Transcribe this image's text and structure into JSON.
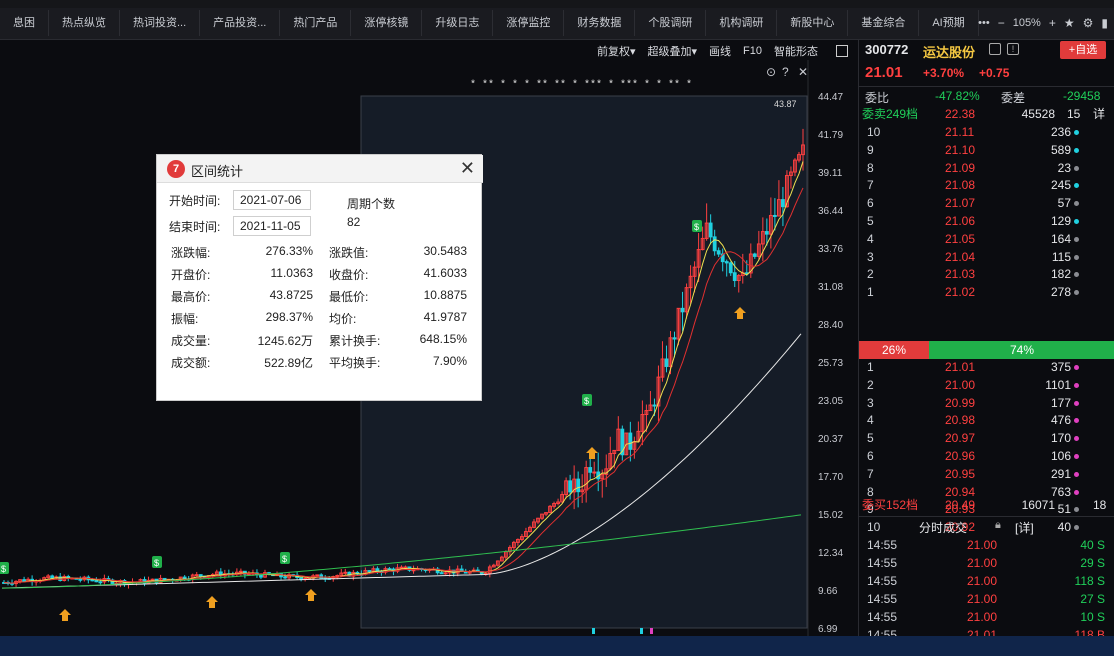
{
  "topnav": {
    "tabs": [
      "息困",
      "热点纵览",
      "热词投资...",
      "产品投资...",
      "热门产品",
      "涨停核镜",
      "升级日志",
      "涨停监控",
      "财务数据",
      "个股调研",
      "机构调研",
      "新股中心",
      "基金综合",
      "AI预期"
    ],
    "more": "•••",
    "zoom_minus": "−",
    "zoom": "105%",
    "zoom_plus": "+"
  },
  "chart_toolbar": [
    "前复权▾",
    "超级叠加▾",
    "画线",
    "F10",
    "智能形态"
  ],
  "chart": {
    "price_ticks": [
      "44.47",
      "41.79",
      "39.11",
      "36.44",
      "33.76",
      "31.08",
      "28.40",
      "25.73",
      "23.05",
      "20.37",
      "17.70",
      "15.02",
      "12.34",
      "9.66",
      "6.99"
    ],
    "hover_value": "43.87",
    "star_marks": "* ** * * *     **   **   *  ***  *    *** *             *          **     *"
  },
  "stock": {
    "code": "300772",
    "name": "运达股份",
    "add_label": "+自选",
    "price": "21.01",
    "pct": "+3.70%",
    "chg": "+0.75",
    "weibi_label": "委比",
    "weibi": "-47.82%",
    "weicha_label": "委差",
    "weicha": "-29458",
    "sell_header_label": "委卖249档",
    "sell_header_price": "22.38",
    "sell_header_qty": "45528",
    "sell_header_count": "15",
    "sell_header_detail": "详",
    "sell": [
      {
        "lv": "10",
        "p": "21.11",
        "q": "236"
      },
      {
        "lv": "9",
        "p": "21.10",
        "q": "589"
      },
      {
        "lv": "8",
        "p": "21.09",
        "q": "23"
      },
      {
        "lv": "7",
        "p": "21.08",
        "q": "245"
      },
      {
        "lv": "6",
        "p": "21.07",
        "q": "57"
      },
      {
        "lv": "5",
        "p": "21.06",
        "q": "129"
      },
      {
        "lv": "4",
        "p": "21.05",
        "q": "164"
      },
      {
        "lv": "3",
        "p": "21.04",
        "q": "115"
      },
      {
        "lv": "2",
        "p": "21.03",
        "q": "182"
      },
      {
        "lv": "1",
        "p": "21.02",
        "q": "278"
      }
    ],
    "ratio_red": "26%",
    "ratio_green": "74%",
    "buy": [
      {
        "lv": "1",
        "p": "21.01",
        "q": "375"
      },
      {
        "lv": "2",
        "p": "21.00",
        "q": "1101"
      },
      {
        "lv": "3",
        "p": "20.99",
        "q": "177"
      },
      {
        "lv": "4",
        "p": "20.98",
        "q": "476"
      },
      {
        "lv": "5",
        "p": "20.97",
        "q": "170"
      },
      {
        "lv": "6",
        "p": "20.96",
        "q": "106"
      },
      {
        "lv": "7",
        "p": "20.95",
        "q": "291"
      },
      {
        "lv": "8",
        "p": "20.94",
        "q": "763"
      },
      {
        "lv": "9",
        "p": "20.93",
        "q": "51"
      },
      {
        "lv": "10",
        "p": "20.92",
        "q": "40"
      }
    ],
    "buy_header_label": "委买152档",
    "buy_header_price": "20.49",
    "buy_header_qty": "16071",
    "buy_header_count": "18",
    "trades_title": "分时成交",
    "trades_detail": "[详]",
    "trades": [
      {
        "t": "14:55",
        "p": "21.00",
        "v": "40 S"
      },
      {
        "t": "14:55",
        "p": "21.00",
        "v": "29 S"
      },
      {
        "t": "14:55",
        "p": "21.00",
        "v": "118 S"
      },
      {
        "t": "14:55",
        "p": "21.00",
        "v": "27 S"
      },
      {
        "t": "14:55",
        "p": "21.00",
        "v": "10 S"
      },
      {
        "t": "14:55",
        "p": "21.01",
        "v": "118 B"
      }
    ]
  },
  "dialog": {
    "title": "区间统计",
    "start_label": "开始时间:",
    "start": "2021-07-06",
    "end_label": "结束时间:",
    "end": "2021-11-05",
    "period_label": "周期个数",
    "period": "82",
    "rows": [
      {
        "l1": "涨跌幅:",
        "v1": "276.33%",
        "l2": "涨跌值:",
        "v2": "30.5483"
      },
      {
        "l1": "开盘价:",
        "v1": "11.0363",
        "l2": "收盘价:",
        "v2": "41.6033"
      },
      {
        "l1": "最高价:",
        "v1": "43.8725",
        "l2": "最低价:",
        "v2": "10.8875"
      },
      {
        "l1": "振幅:",
        "v1": "298.37%",
        "l2": "均价:",
        "v2": "41.9787"
      },
      {
        "l1": "成交量:",
        "v1": "1245.62万",
        "l2": "累计换手:",
        "v2": "648.15%"
      },
      {
        "l1": "成交额:",
        "v1": "522.89亿",
        "l2": "平均换手:",
        "v2": "7.90%"
      }
    ]
  },
  "colors": {
    "up": "#ff4040",
    "down": "#20d0e0",
    "ma5": "#f0e050",
    "ma10": "#e03030",
    "ma20": "#e8e8e8",
    "ma60": "#30c050"
  }
}
